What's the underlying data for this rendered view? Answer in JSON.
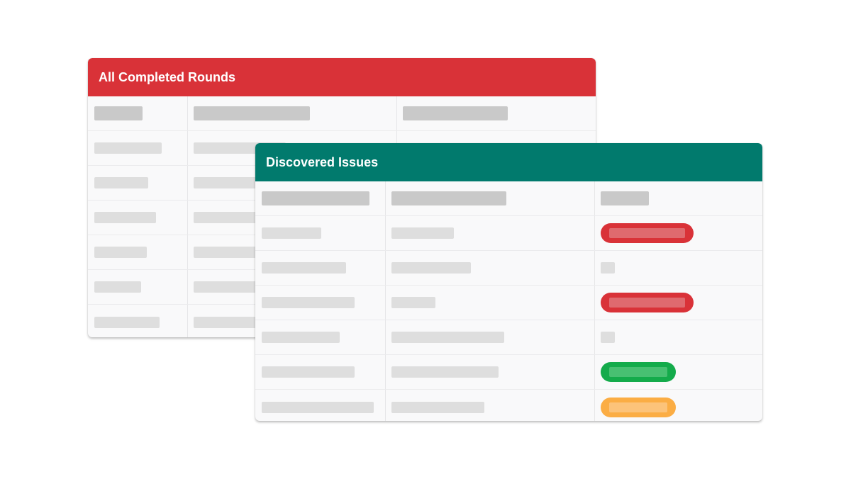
{
  "colors": {
    "rounds_header": "#d93238",
    "issues_header": "#017a6d",
    "status_red": "#d93238",
    "status_red_inner": "#df6a6f",
    "status_green": "#14ab4b",
    "status_green_inner": "#48c072",
    "status_orange": "#fbad44",
    "status_orange_inner": "#fcc37a"
  },
  "rounds_panel": {
    "title": "All Completed Rounds"
  },
  "issues_panel": {
    "title": "Discovered Issues",
    "statuses": [
      "red",
      "none",
      "red",
      "none",
      "green",
      "orange"
    ]
  }
}
